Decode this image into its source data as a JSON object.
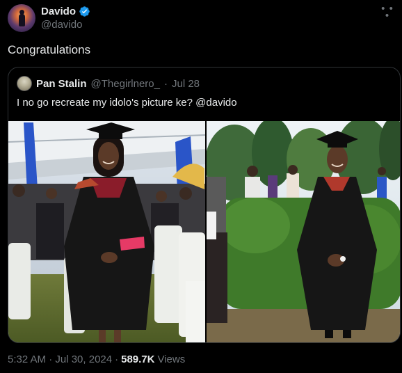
{
  "tweet": {
    "author_name": "Davido",
    "author_handle": "@davido",
    "text": "Congratulations",
    "timestamp": "5:32 AM · Jul 30, 2024",
    "separator": "·",
    "views_count": "589.7K",
    "views_label": "Views"
  },
  "quote": {
    "author_name": "Pan Stalin",
    "author_handle": "@Thegirlnero_",
    "separator": "·",
    "date": "Jul 28",
    "text": "I no go recreate my idolo's picture ke? @davido"
  },
  "colors": {
    "background": "#000000",
    "text_primary": "#e7e9ea",
    "text_secondary": "#71767b",
    "verified": "#1d9bf0",
    "border": "#2f3336"
  },
  "icons": {
    "more": "more-icon",
    "verified": "verified-badge-icon"
  }
}
